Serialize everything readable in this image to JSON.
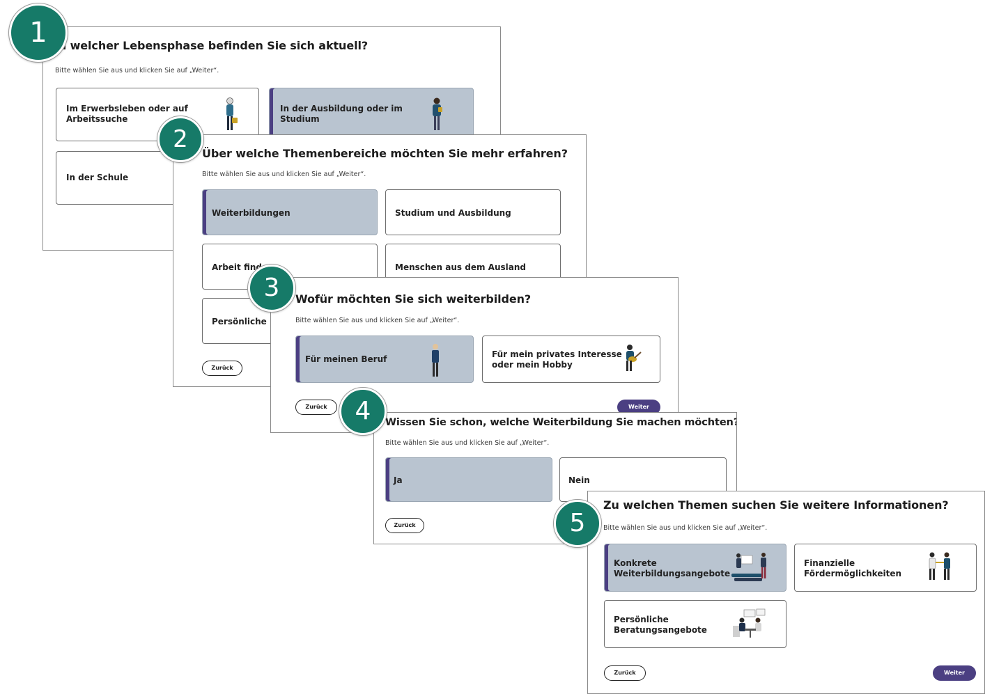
{
  "subtitle": "Bitte wählen Sie aus und klicken Sie auf „Weiter“.",
  "buttons": {
    "back": "Zurück",
    "next": "Weiter"
  },
  "colors": {
    "accent": "#4b3f82",
    "selected_card": "#b9c4d0",
    "badge": "#167a68"
  },
  "steps": [
    {
      "number": "1",
      "title": "In welcher Lebensphase befinden Sie sich aktuell?",
      "options": [
        {
          "line1": "Im Erwerbsleben oder auf",
          "line2": "Arbeitssuche",
          "selected": false,
          "icon": "person-with-bag-icon"
        },
        {
          "line1": "In der Ausbildung oder im",
          "line2": "Studium",
          "selected": true,
          "icon": "student-icon"
        },
        {
          "line1": "In der Schule",
          "line2": "",
          "selected": false
        }
      ]
    },
    {
      "number": "2",
      "title": "Über welche Themenbereiche möchten Sie mehr erfahren?",
      "options": [
        {
          "line1": "Weiterbildungen",
          "selected": true
        },
        {
          "line1": "Studium und Ausbildung",
          "selected": false
        },
        {
          "line1": "Arbeit finden",
          "selected": false
        },
        {
          "line1": "Menschen aus dem Ausland",
          "selected": false
        },
        {
          "line1": "Persönliche Beratung",
          "selected": false
        }
      ]
    },
    {
      "number": "3",
      "title": "Wofür möchten Sie sich weiterbilden?",
      "options": [
        {
          "line1": "Für meinen Beruf",
          "line2": "",
          "selected": true,
          "icon": "professional-person-icon"
        },
        {
          "line1": "Für mein privates Interesse",
          "line2": "oder mein Hobby",
          "selected": false,
          "icon": "guitar-player-icon"
        }
      ]
    },
    {
      "number": "4",
      "title": "Wissen Sie schon, welche Weiterbildung Sie machen möchten?",
      "options": [
        {
          "line1": "Ja",
          "selected": true
        },
        {
          "line1": "Nein",
          "selected": false
        }
      ]
    },
    {
      "number": "5",
      "title": "Zu welchen Themen suchen Sie weitere Informationen?",
      "options": [
        {
          "line1": "Konkrete",
          "line2": "Weiterbildungsangebote",
          "selected": true,
          "icon": "training-offers-icon"
        },
        {
          "line1": "Finanzielle",
          "line2": "Fördermöglichkeiten",
          "selected": false,
          "icon": "funding-handshake-icon"
        },
        {
          "line1": "Persönliche",
          "line2": "Beratungsangebote",
          "selected": false,
          "icon": "consultation-icon"
        }
      ]
    }
  ]
}
